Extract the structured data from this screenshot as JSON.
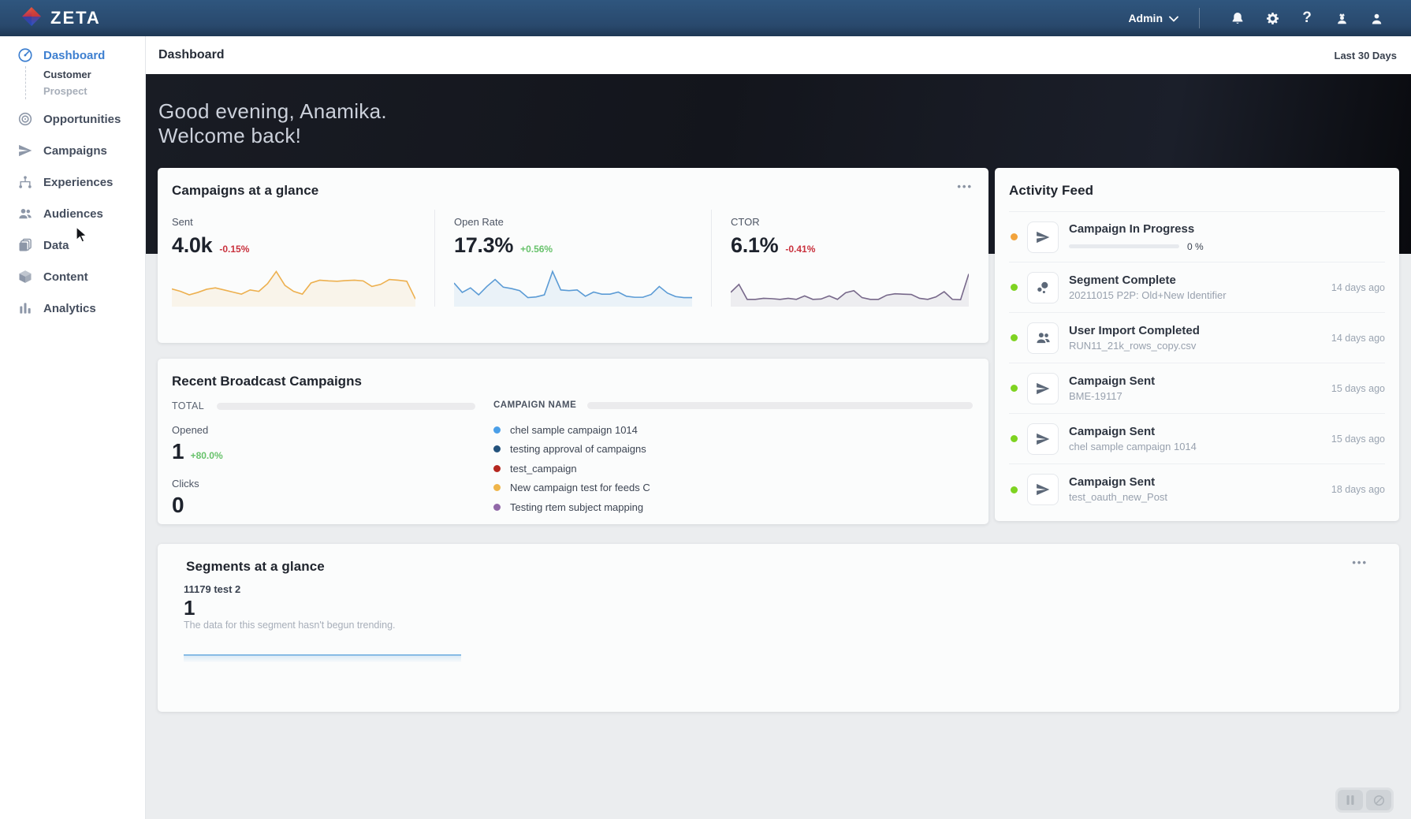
{
  "topnav": {
    "brand": "ZETA",
    "admin_label": "Admin",
    "icons": [
      "bell",
      "gear",
      "help",
      "admin-user",
      "user"
    ]
  },
  "sidebar": {
    "items": [
      {
        "label": "Dashboard",
        "icon": "dashboard",
        "active": true,
        "children": [
          {
            "label": "Customer",
            "strong": true
          },
          {
            "label": "Prospect",
            "strong": false
          }
        ]
      },
      {
        "label": "Opportunities",
        "icon": "target"
      },
      {
        "label": "Campaigns",
        "icon": "plane"
      },
      {
        "label": "Experiences",
        "icon": "flow"
      },
      {
        "label": "Audiences",
        "icon": "people"
      },
      {
        "label": "Data",
        "icon": "files"
      },
      {
        "label": "Content",
        "icon": "cube"
      },
      {
        "label": "Analytics",
        "icon": "bars"
      }
    ]
  },
  "header": {
    "title": "Dashboard",
    "date_range": "Last 30 Days"
  },
  "hero": {
    "line1": "Good evening, Anamika.",
    "line2": "Welcome back!"
  },
  "campaigns_glance": {
    "title": "Campaigns at a glance",
    "menu": "•••",
    "metrics": [
      {
        "label": "Sent",
        "value": "4.0k",
        "delta": "-0.15%",
        "delta_color": "#c9313d",
        "line_color": "#edb04f",
        "spark": [
          45,
          38,
          28,
          35,
          44,
          48,
          42,
          36,
          30,
          42,
          38,
          60,
          95,
          55,
          38,
          30,
          62,
          70,
          68,
          67,
          69,
          70,
          68,
          52,
          58,
          72,
          70,
          67,
          16
        ]
      },
      {
        "label": "Open Rate",
        "value": "17.3%",
        "delta": "+0.56%",
        "delta_color": "#67c26b",
        "line_color": "#5b9bd5",
        "spark": [
          62,
          35,
          48,
          28,
          52,
          72,
          50,
          46,
          40,
          20,
          22,
          28,
          95,
          42,
          40,
          42,
          24,
          36,
          30,
          30,
          36,
          24,
          21,
          21,
          29,
          52,
          33,
          23,
          20,
          20
        ]
      },
      {
        "label": "CTOR",
        "value": "6.1%",
        "delta": "-0.41%",
        "delta_color": "#c9313d",
        "line_color": "#77688a",
        "spark": [
          35,
          58,
          15,
          15,
          18,
          17,
          15,
          18,
          15,
          25,
          15,
          16,
          25,
          15,
          34,
          40,
          20,
          15,
          15,
          27,
          31,
          30,
          29,
          18,
          15,
          22,
          37,
          15,
          14,
          88
        ]
      }
    ]
  },
  "activity_feed": {
    "title": "Activity Feed",
    "items": [
      {
        "dot": "#f2a33c",
        "icon": "plane",
        "title": "Campaign In Progress",
        "subtitle": "",
        "progress": "0 %",
        "time": ""
      },
      {
        "dot": "#7ed321",
        "icon": "segment",
        "title": "Segment Complete",
        "subtitle": "20211015 P2P: Old+New Identifier",
        "time": "14 days ago"
      },
      {
        "dot": "#7ed321",
        "icon": "users",
        "title": "User Import Completed",
        "subtitle": "RUN11_21k_rows_copy.csv",
        "time": "14 days ago"
      },
      {
        "dot": "#7ed321",
        "icon": "plane",
        "title": "Campaign Sent",
        "subtitle": "BME-19117",
        "time": "15 days ago"
      },
      {
        "dot": "#7ed321",
        "icon": "plane",
        "title": "Campaign Sent",
        "subtitle": "chel sample campaign 1014",
        "time": "15 days ago"
      },
      {
        "dot": "#7ed321",
        "icon": "plane",
        "title": "Campaign Sent",
        "subtitle": "test_oauth_new_Post",
        "time": "18 days ago"
      }
    ]
  },
  "recent_broadcast": {
    "title": "Recent Broadcast Campaigns",
    "total_label": "TOTAL",
    "opened_label": "Opened",
    "opened_value": "1",
    "opened_delta": "+80.0%",
    "clicks_label": "Clicks",
    "clicks_value": "0",
    "column_header": "CAMPAIGN NAME",
    "legend": [
      {
        "color": "#4a9fe8",
        "label": "chel sample campaign 1014"
      },
      {
        "color": "#23527c",
        "label": "testing approval of campaigns"
      },
      {
        "color": "#b5271f",
        "label": "test_campaign"
      },
      {
        "color": "#efb54a",
        "label": "New campaign test for feeds C"
      },
      {
        "color": "#9168a8",
        "label": "Testing rtem subject mapping"
      }
    ]
  },
  "segments_glance": {
    "title": "Segments at a glance",
    "menu": "•••",
    "segment_name": "11179 test 2",
    "segment_value": "1",
    "note": "The data for this segment hasn't begun trending.",
    "line_color": "#88bce5"
  }
}
